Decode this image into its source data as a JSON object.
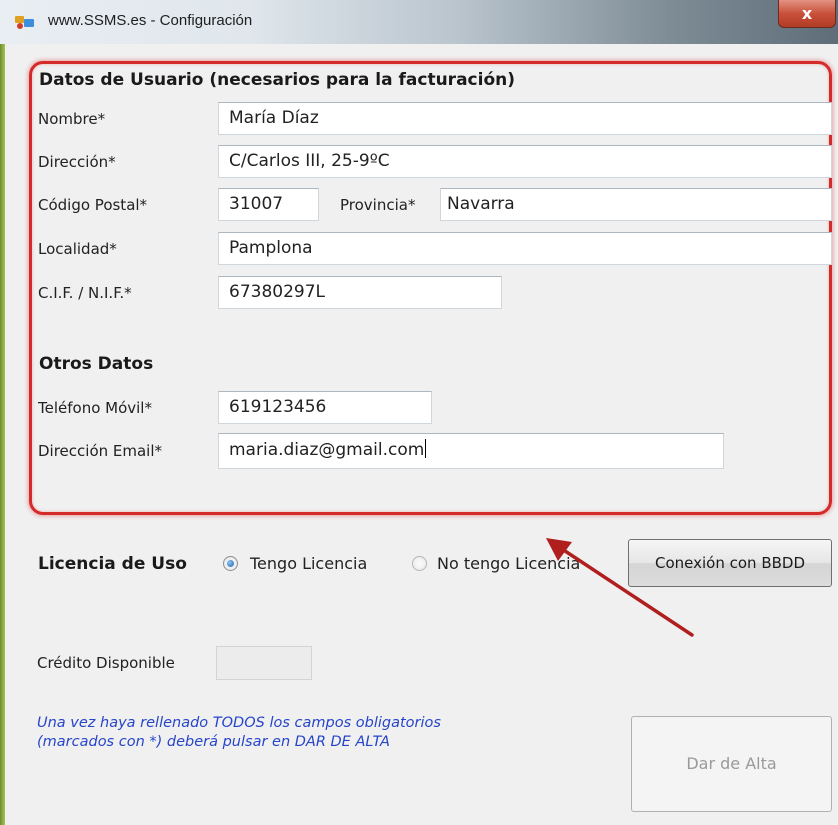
{
  "window": {
    "title": "www.SSMS.es - Configuración",
    "close_label": "x"
  },
  "user_data": {
    "heading": "Datos de Usuario (necesarios para la facturación)",
    "fields": {
      "nombre": {
        "label": "Nombre*",
        "value": "María Díaz"
      },
      "direccion": {
        "label": "Dirección*",
        "value": "C/Carlos III, 25-9ºC"
      },
      "codigo_postal": {
        "label": "Código Postal*",
        "value": "31007"
      },
      "provincia": {
        "label": "Provincia*",
        "value": "Navarra"
      },
      "localidad": {
        "label": "Localidad*",
        "value": "Pamplona"
      },
      "cif_nif": {
        "label": "C.I.F. / N.I.F.*",
        "value": "67380297L"
      }
    }
  },
  "other_data": {
    "heading": "Otros Datos",
    "fields": {
      "telefono_movil": {
        "label": "Teléfono Móvil*",
        "value": "619123456"
      },
      "email": {
        "label": "Dirección Email*",
        "value": "maria.diaz@gmail.com"
      }
    }
  },
  "license": {
    "label": "Licencia de Uso",
    "options": [
      {
        "label": "Tengo Licencia",
        "selected": true
      },
      {
        "label": "No tengo Licencia",
        "selected": false
      }
    ],
    "db_button": "Conexión con BBDD"
  },
  "credit": {
    "label": "Crédito Disponible",
    "value": ""
  },
  "instructions": [
    "Una vez haya rellenado TODOS los campos obligatorios",
    "(marcados con *) deberá pulsar en DAR DE ALTA"
  ],
  "register_button": "Dar de Alta",
  "colors": {
    "highlight_border": "#d42a2a",
    "annotation_arrow": "#b01e1e",
    "instruction_text": "#2645c9"
  }
}
